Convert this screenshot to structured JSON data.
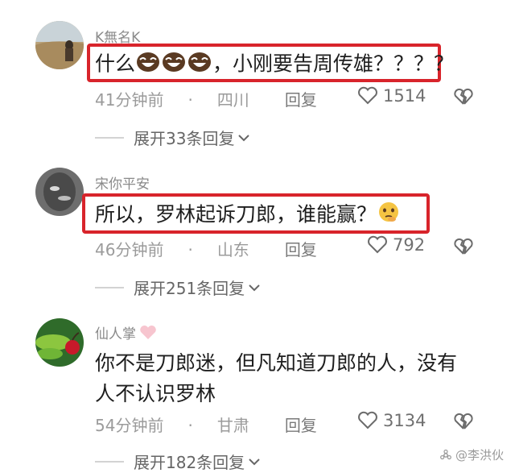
{
  "comments": [
    {
      "username": "K無名K",
      "text_prefix": "什么",
      "text_suffix": "，小刚要告周传雄？？？？",
      "emoji": "laughing-face-emoji",
      "time": "41分钟前",
      "location": "四川",
      "reply_label": "回复",
      "likes": "1514",
      "expand_label": "展开33条回复",
      "highlighted": true
    },
    {
      "username": "宋你平安",
      "text_prefix": "所以，罗林起诉刀郎，谁能赢？",
      "emoji": "thinking-face-emoji",
      "time": "46分钟前",
      "location": "山东",
      "reply_label": "回复",
      "likes": "792",
      "expand_label": "展开251条回复",
      "highlighted": true
    },
    {
      "username": "仙人掌",
      "username_emoji": "pink-heart-emoji",
      "text_line1": "你不是刀郎迷，但凡知道刀郎的人，没有",
      "text_line2": "人不认识罗林",
      "time": "54分钟前",
      "location": "甘肃",
      "reply_label": "回复",
      "likes": "3134",
      "expand_label": "展开182条回复",
      "highlighted": false
    }
  ],
  "watermark": "@李洪伙",
  "colors": {
    "highlight_border": "#d8242b",
    "meta_text": "#9b9b9b",
    "username_text": "#8a8a8a"
  },
  "icons": {
    "like": "heart-outline-icon",
    "dislike": "broken-heart-icon",
    "expand": "chevron-down-icon"
  }
}
